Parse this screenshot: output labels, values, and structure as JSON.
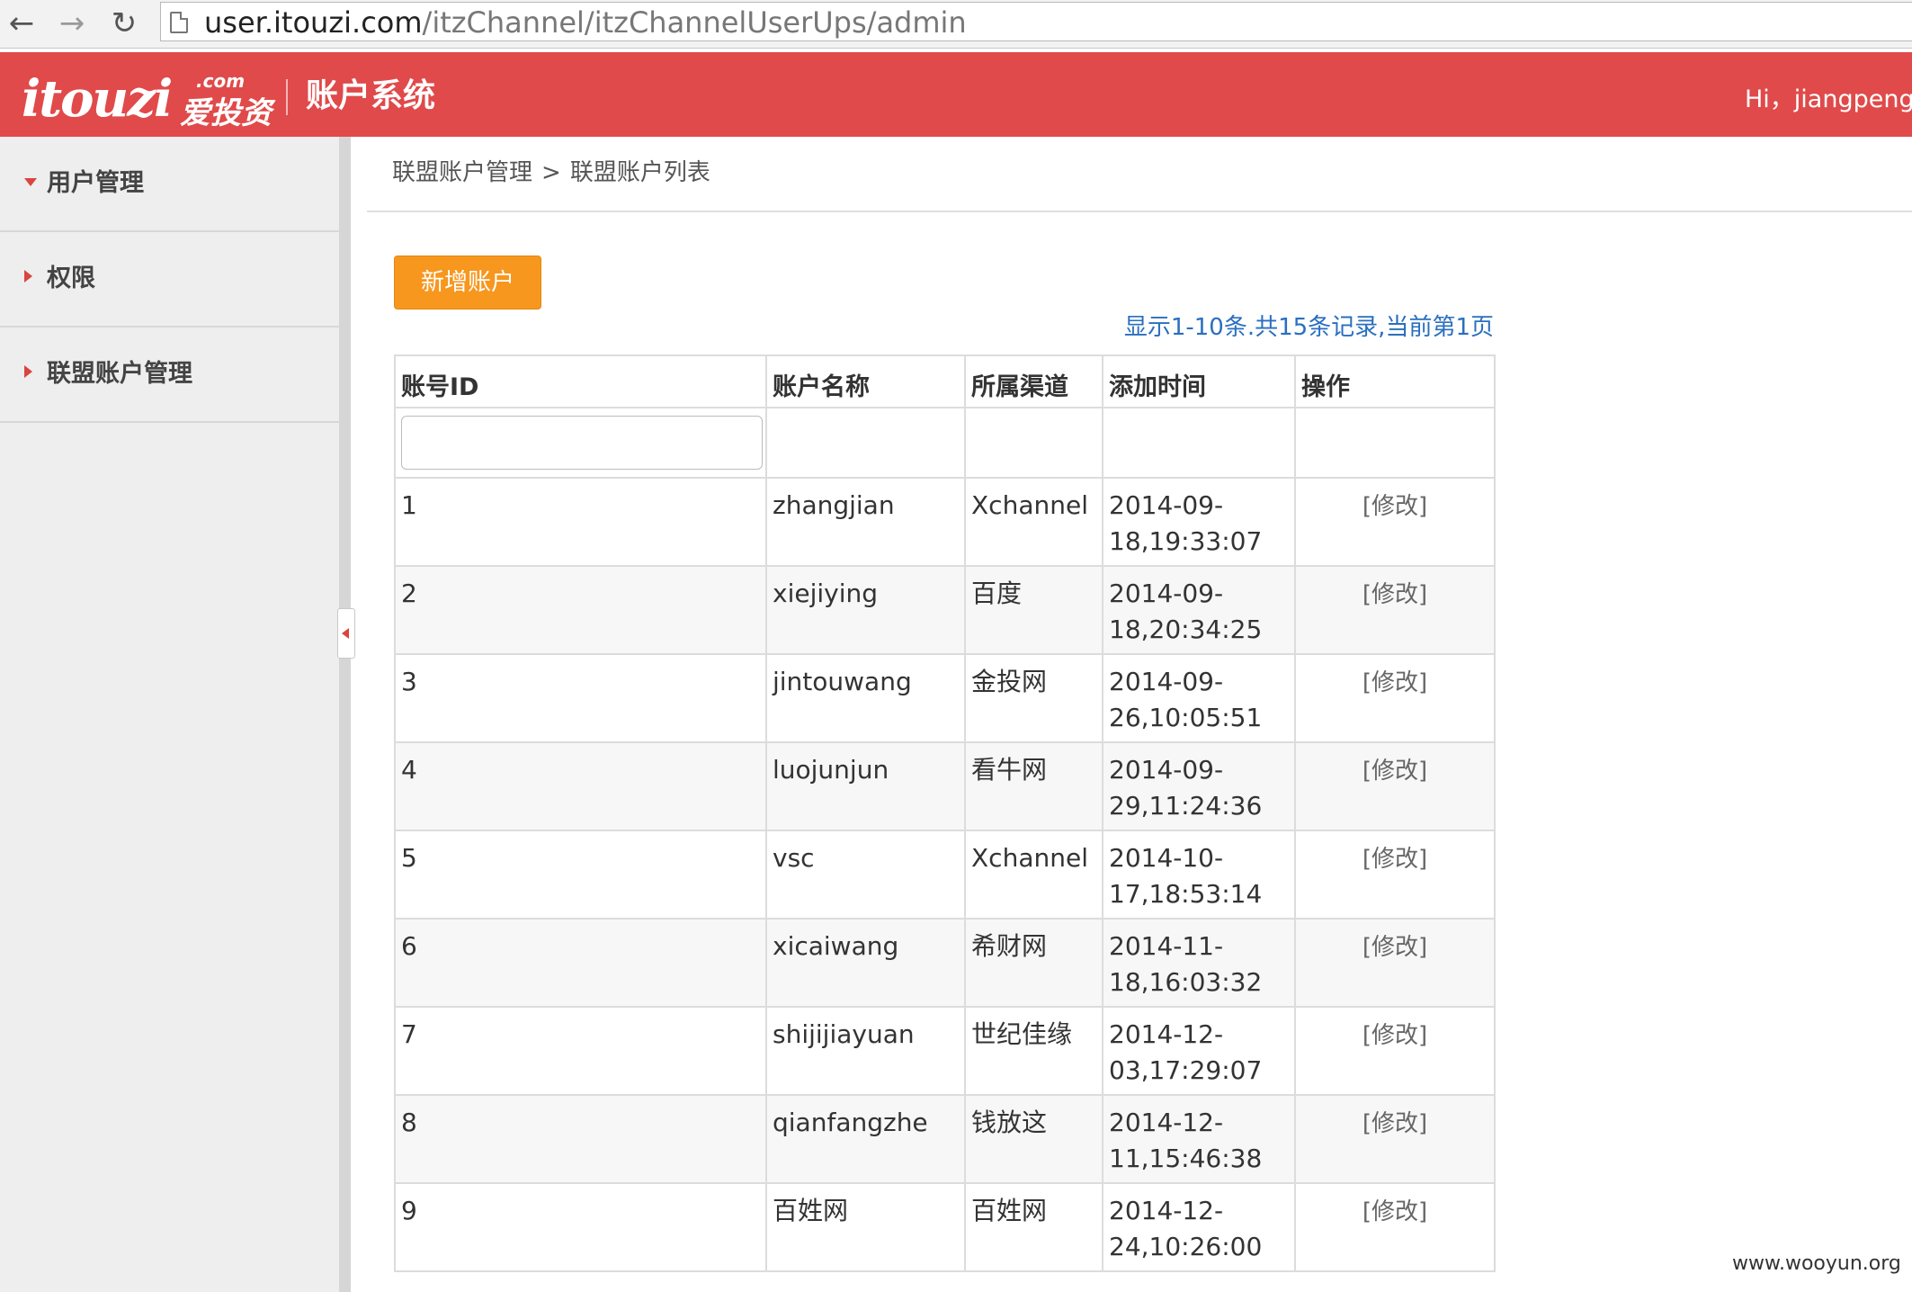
{
  "browser": {
    "url_host": "user.itouzi.com",
    "url_path": "/itzChannel/itzChannelUserUps/admin",
    "back_icon": "←",
    "forward_icon": "→",
    "reload_icon": "↻"
  },
  "header": {
    "logo_text": "itouzi",
    "logo_com": ".com",
    "logo_cn": "爱投资",
    "system_title": "账户系统",
    "greeting": "Hi，jiangpengl",
    "color": "#e04a4a"
  },
  "sidebar": {
    "items": [
      {
        "label": "用户管理",
        "expanded": true
      },
      {
        "label": "权限",
        "expanded": false
      },
      {
        "label": "联盟账户管理",
        "expanded": false
      }
    ]
  },
  "breadcrumb": {
    "parent": "联盟账户管理",
    "separator": ">",
    "current": "联盟账户列表"
  },
  "toolbar": {
    "add_label": "新增账户",
    "accent": "#f7971e"
  },
  "summary": "显示1-10条.共15条记录,当前第1页",
  "table": {
    "columns": [
      "账号ID",
      "账户名称",
      "所属渠道",
      "添加时间",
      "操作"
    ],
    "filter_value": "",
    "rows": [
      {
        "id": "1",
        "name": "zhangjian",
        "channel": "Xchannel",
        "date": "2014-09-",
        "time": "18,19:33:07",
        "action": "[修改]"
      },
      {
        "id": "2",
        "name": "xiejiying",
        "channel": "百度",
        "date": "2014-09-",
        "time": "18,20:34:25",
        "action": "[修改]"
      },
      {
        "id": "3",
        "name": "jintouwang",
        "channel": "金投网",
        "date": "2014-09-",
        "time": "26,10:05:51",
        "action": "[修改]"
      },
      {
        "id": "4",
        "name": "luojunjun",
        "channel": "看牛网",
        "date": "2014-09-",
        "time": "29,11:24:36",
        "action": "[修改]"
      },
      {
        "id": "5",
        "name": "vsc",
        "channel": "Xchannel",
        "date": "2014-10-",
        "time": "17,18:53:14",
        "action": "[修改]"
      },
      {
        "id": "6",
        "name": "xicaiwang",
        "channel": "希财网",
        "date": "2014-11-",
        "time": "18,16:03:32",
        "action": "[修改]"
      },
      {
        "id": "7",
        "name": "shijijiayuan",
        "channel": "世纪佳缘",
        "date": "2014-12-",
        "time": "03,17:29:07",
        "action": "[修改]"
      },
      {
        "id": "8",
        "name": "qianfangzhe",
        "channel": "钱放这",
        "date": "2014-12-",
        "time": "11,15:46:38",
        "action": "[修改]"
      },
      {
        "id": "9",
        "name": "百姓网",
        "channel": "百姓网",
        "date": "2014-12-",
        "time": "24,10:26:00",
        "action": "[修改]"
      }
    ]
  },
  "watermark": "www.wooyun.org"
}
